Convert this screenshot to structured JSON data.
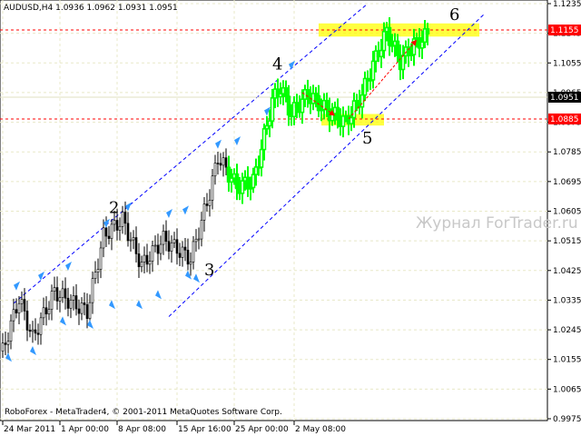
{
  "title": "AUDUSD,H4  1.0936 1.0962 1.0931 1.0951",
  "footer": "RoboForex - MetaTrader4, © 2001-2011 MetaQuotes Software Corp.",
  "watermark": "Журнал ForTrader.ru",
  "colors": {
    "bull": "#00ff00",
    "bear": "#000000",
    "fractal": "#3399ff",
    "level": "#ff0000",
    "zone": "#ffff00",
    "channel": "#0000ff"
  },
  "chart_data": {
    "type": "candlestick",
    "symbol": "AUDUSD",
    "timeframe": "H4",
    "ylim": [
      0.9975,
      1.1235
    ],
    "y_ticks": [
      "1.1235",
      "1.1145",
      "1.1055",
      "1.0965",
      "1.0875",
      "1.0785",
      "1.0695",
      "1.0605",
      "1.0515",
      "1.0425",
      "1.0335",
      "1.0245",
      "1.0155",
      "1.0065",
      "0.9975"
    ],
    "x_ticks": [
      {
        "bar": 1,
        "label": "24 Mar 2011"
      },
      {
        "bar": 22,
        "label": "1 Apr 00:00"
      },
      {
        "bar": 43,
        "label": "8 Apr 08:00"
      },
      {
        "bar": 65,
        "label": "15 Apr 16:00"
      },
      {
        "bar": 86,
        "label": "25 Apr 00:00"
      },
      {
        "bar": 108,
        "label": "2 May 08:00"
      }
    ],
    "price_path": [
      [
        1,
        1.018
      ],
      [
        7,
        1.034
      ],
      [
        12,
        1.022
      ],
      [
        20,
        1.036
      ],
      [
        32,
        1.03
      ],
      [
        38,
        1.053
      ],
      [
        45,
        1.058
      ],
      [
        52,
        1.044
      ],
      [
        60,
        1.052
      ],
      [
        70,
        1.046
      ],
      [
        77,
        1.066
      ],
      [
        80,
        1.077
      ],
      [
        87,
        1.068
      ],
      [
        93,
        1.0695
      ],
      [
        97,
        1.083
      ],
      [
        100,
        1.094
      ],
      [
        103,
        1.098
      ],
      [
        107,
        1.09
      ],
      [
        113,
        1.096
      ],
      [
        120,
        1.091
      ],
      [
        127,
        1.0875
      ],
      [
        133,
        1.096
      ],
      [
        137,
        1.105
      ],
      [
        142,
        1.115
      ],
      [
        147,
        1.106
      ],
      [
        152,
        1.111
      ],
      [
        157,
        1.114
      ]
    ],
    "green_from_bar": 84,
    "levels": [
      {
        "price": 1.1155,
        "label": "1.1155"
      },
      {
        "price": 1.0885,
        "label": "1.0885"
      }
    ],
    "bid": {
      "price": 1.0951,
      "label": "1.0951"
    },
    "wave_labels": [
      {
        "text": "2",
        "bar": 40,
        "price": 1.06
      },
      {
        "text": "3",
        "bar": 75,
        "price": 1.041
      },
      {
        "text": "4",
        "bar": 100,
        "price": 1.1035
      },
      {
        "text": "5",
        "bar": 133,
        "price": 1.081
      },
      {
        "text": "6",
        "bar": 165,
        "price": 1.1185
      }
    ],
    "channel": [
      {
        "from": [
          5,
          1.0325
        ],
        "to": [
          135,
          1.1235
        ]
      },
      {
        "from": [
          62,
          1.0285
        ],
        "to": [
          178,
          1.1205
        ]
      }
    ],
    "zones": [
      {
        "bars": [
          117,
          176
        ],
        "prices": [
          1.1135,
          1.1175
        ]
      },
      {
        "bars": [
          118,
          141
        ],
        "prices": [
          1.0865,
          1.09
        ]
      }
    ],
    "arrows": [
      {
        "from": [
          111,
          1.0965
        ],
        "to": [
          123,
          1.0895
        ]
      },
      {
        "from": [
          128,
          1.0885
        ],
        "to": [
          153,
          1.1125
        ]
      }
    ],
    "fractals_up": [
      [
        5,
        1.037
      ],
      [
        14,
        1.04
      ],
      [
        24,
        1.043
      ],
      [
        38,
        1.056
      ],
      [
        46,
        1.061
      ],
      [
        61,
        1.059
      ],
      [
        67,
        1.06
      ],
      [
        79,
        1.08
      ],
      [
        86,
        1.081
      ],
      [
        97,
        1.09
      ],
      [
        106,
        1.104
      ]
    ],
    "fractals_down": [
      [
        2,
        1.017
      ],
      [
        11,
        1.019
      ],
      [
        22,
        1.028
      ],
      [
        32,
        1.027
      ],
      [
        40,
        1.033
      ],
      [
        50,
        1.033
      ],
      [
        57,
        1.036
      ],
      [
        68,
        1.042
      ],
      [
        71,
        1.041
      ]
    ]
  }
}
